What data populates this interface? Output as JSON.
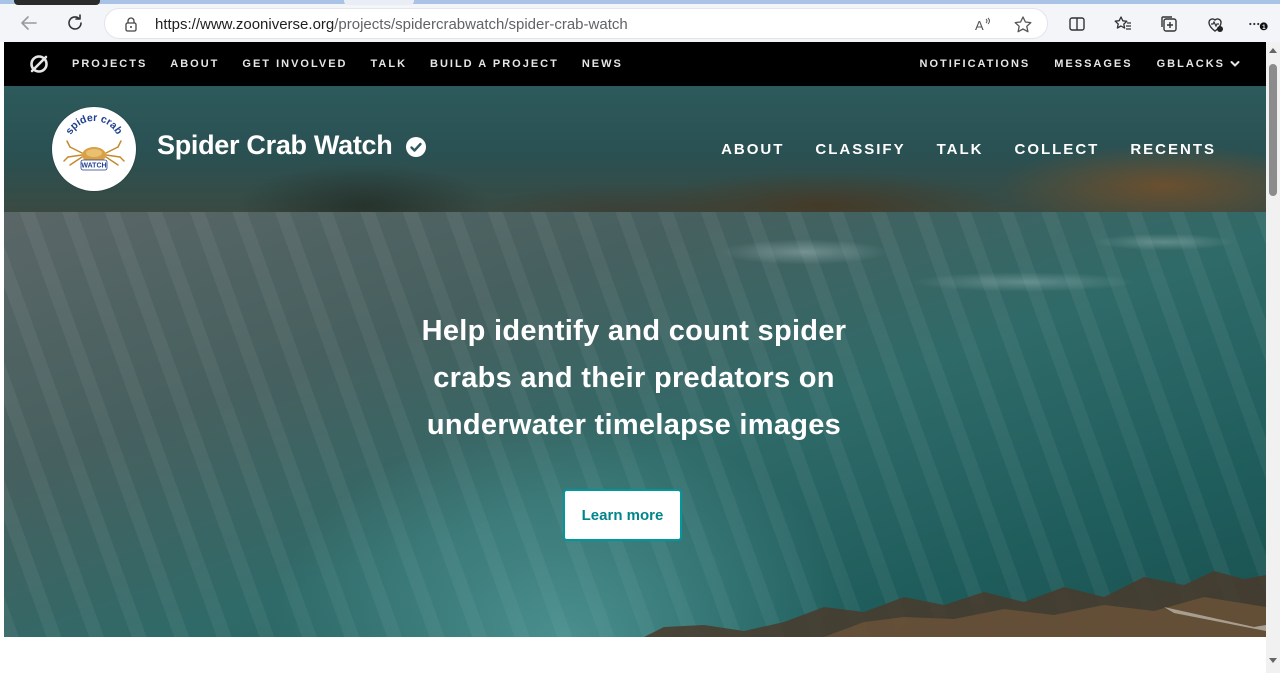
{
  "browser": {
    "url_host": "https://www.zooniverse.org",
    "url_path": "/projects/spidercrabwatch/spider-crab-watch",
    "icons": [
      "back-icon",
      "refresh-icon",
      "lock-icon",
      "read-aloud-icon",
      "favorite-star-icon",
      "split-screen-icon",
      "favorites-icon",
      "collections-icon",
      "health-icon",
      "more-icon"
    ],
    "notification_count": "1"
  },
  "zooniverse_nav": {
    "links": [
      "PROJECTS",
      "ABOUT",
      "GET INVOLVED",
      "TALK",
      "BUILD A PROJECT",
      "NEWS"
    ],
    "right_links": [
      "NOTIFICATIONS",
      "MESSAGES"
    ],
    "user": "GBLACKS"
  },
  "project": {
    "title": "Spider Crab Watch",
    "avatar_text_top": "spider crab",
    "avatar_text_bottom": "WATCH",
    "nav": [
      "ABOUT",
      "CLASSIFY",
      "TALK",
      "COLLECT",
      "RECENTS"
    ]
  },
  "hero": {
    "line1": "Help identify and count spider",
    "line2": "crabs and their predators on",
    "line3": "underwater timelapse images",
    "button": "Learn more"
  },
  "colors": {
    "nav_bg": "#000000",
    "accent": "#00979d",
    "header_teal": "#2d5a5c"
  }
}
